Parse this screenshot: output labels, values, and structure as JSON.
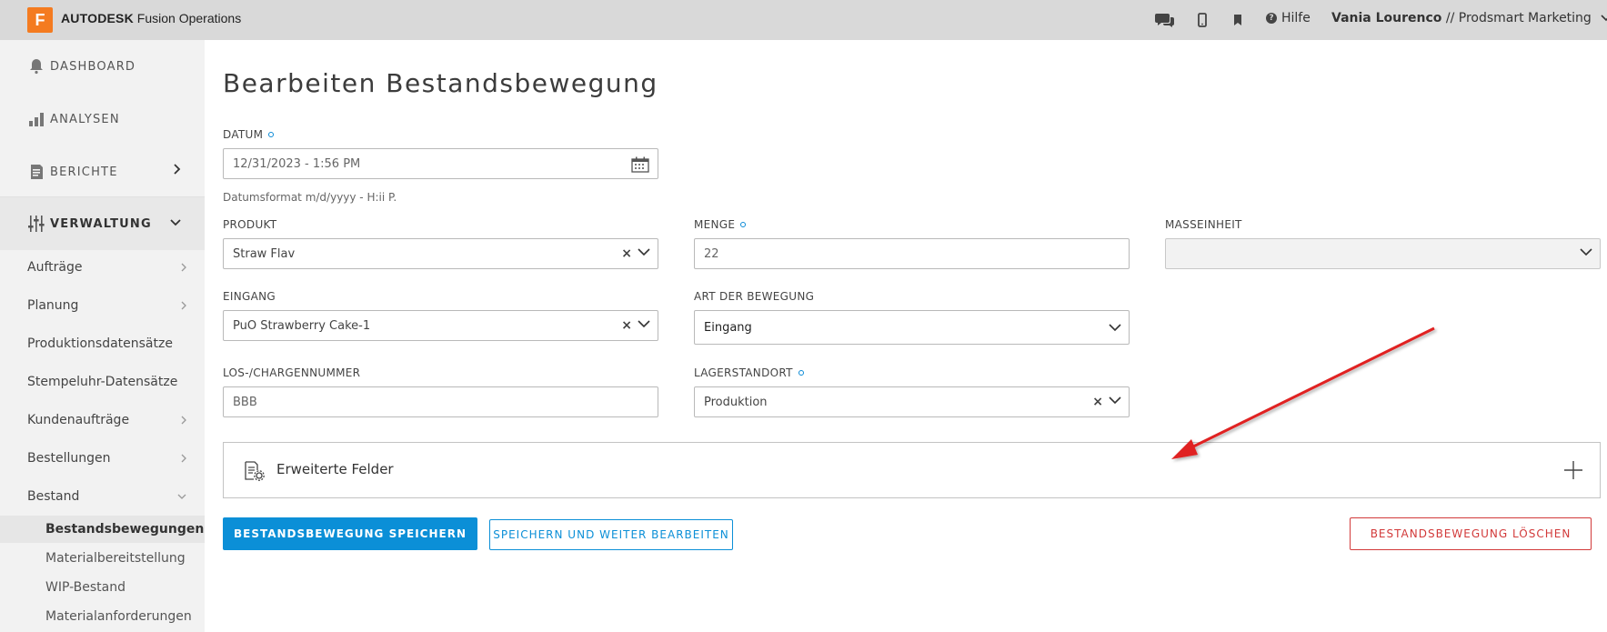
{
  "topbar": {
    "logo_letter": "F",
    "brand_bold": "AUTODESK",
    "brand_rest": "Fusion Operations",
    "icons": [
      "chat-icon",
      "mobile-icon",
      "bookmark-icon"
    ],
    "help_label": "Hilfe",
    "user_name": "Vania Lourenco",
    "user_org": "// Prodsmart Marketing"
  },
  "sidebar": {
    "main": [
      {
        "label": "DASHBOARD",
        "icon": "bell-icon"
      },
      {
        "label": "ANALYSEN",
        "icon": "bar-chart-icon"
      },
      {
        "label": "BERICHTE",
        "icon": "report-icon"
      },
      {
        "label": "VERWALTUNG",
        "icon": "sliders-icon"
      }
    ],
    "sub": [
      "Aufträge",
      "Planung",
      "Produktionsdatensätze",
      "Stempeluhr-Datensätze",
      "Kundenaufträge",
      "Bestellungen",
      "Bestand"
    ],
    "bestand_items": [
      "Bestandsbewegungen",
      "Materialbereitstellung",
      "WIP-Bestand",
      "Materialanforderungen"
    ]
  },
  "form": {
    "title": "Bearbeiten Bestandsbewegung",
    "datum": {
      "label": "DATUM",
      "value": "12/31/2023 - 1:56 PM",
      "hint": "Datumsformat m/d/yyyy - H:ii P."
    },
    "produkt": {
      "label": "PRODUKT",
      "value": "Straw Flav"
    },
    "menge": {
      "label": "MENGE",
      "value": "22"
    },
    "masseinheit": {
      "label": "MASSEINHEIT",
      "value": ""
    },
    "eingang": {
      "label": "EINGANG",
      "value": "PuO Strawberry Cake-1"
    },
    "art": {
      "label": "ART DER BEWEGUNG",
      "value": "Eingang"
    },
    "los": {
      "label": "LOS-/CHARGENNUMMER",
      "value": "BBB"
    },
    "lager": {
      "label": "LAGERSTANDORT",
      "value": "Produktion"
    },
    "extended_label": "Erweiterte Felder"
  },
  "buttons": {
    "save": "BESTANDSBEWEGUNG SPEICHERN",
    "save_continue": "SPEICHERN UND WEITER BEARBEITEN",
    "delete": "BESTANDSBEWEGUNG LÖSCHEN"
  },
  "colors": {
    "accent": "#0b8fd7",
    "danger": "#d23a3a",
    "logo": "#f47b20",
    "annotation": "#e02020"
  }
}
